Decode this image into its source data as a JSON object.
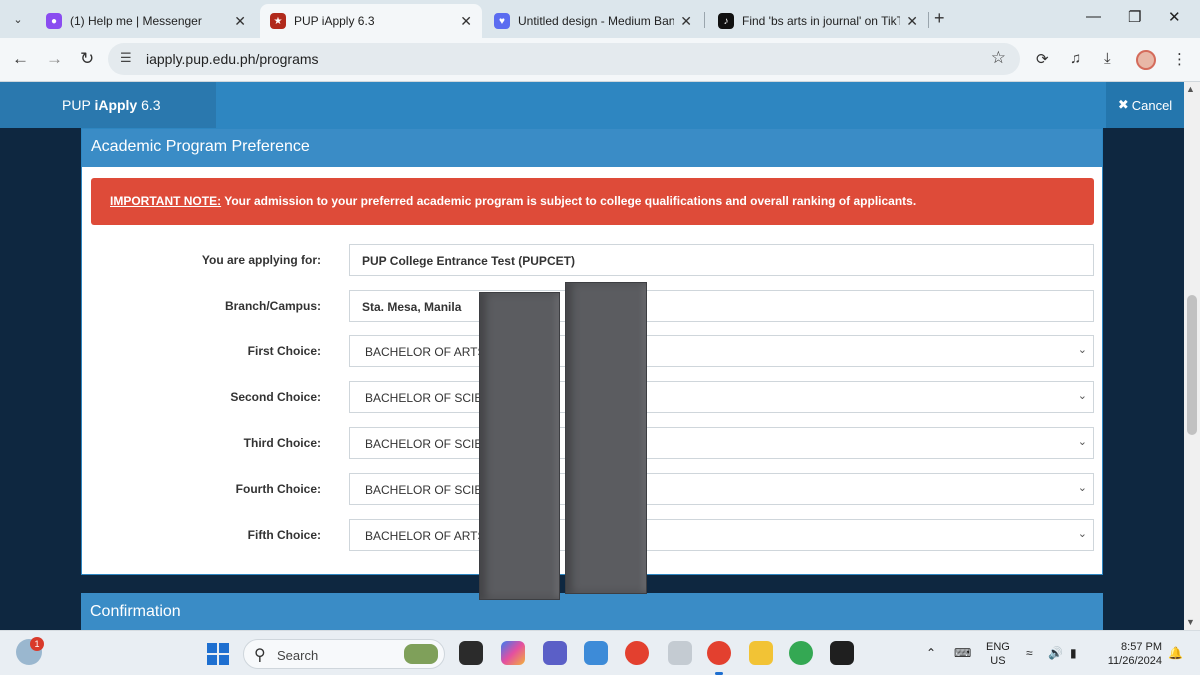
{
  "browser": {
    "tabs": [
      {
        "title": "(1) Help me | Messenger",
        "favicon_color": "#8a4cf0",
        "active": false
      },
      {
        "title": "PUP iApply 6.3",
        "favicon_color": "#b12a1c",
        "active": true
      },
      {
        "title": "Untitled design - Medium Bann",
        "favicon_color": "#5b6cf0",
        "active": false
      },
      {
        "title": "Find 'bs arts in journal' on TikTo",
        "favicon_color": "#111111",
        "active": false
      }
    ],
    "new_tab_label": "+",
    "url": "iapply.pup.edu.ph/programs"
  },
  "app": {
    "brand_prefix": "PUP ",
    "brand_bold": "iApply",
    "brand_version": " 6.3",
    "cancel_label": "Cancel",
    "accent_color": "#2e86c1"
  },
  "preference_panel": {
    "title": "Academic Program Preference",
    "note_label": "IMPORTANT NOTE:",
    "note_text": " Your admission to your preferred academic program is subject to college qualifications and overall ranking of applicants.",
    "applying_for": {
      "label": "You are applying for:",
      "value": "PUP College Entrance Test (PUPCET)"
    },
    "campus": {
      "label": "Branch/Campus:",
      "value": "Sta. Mesa, Manila"
    },
    "choices": [
      {
        "label": "First Choice:",
        "value": "BACHELOR OF ARTS I"
      },
      {
        "label": "Second Choice:",
        "value": "BACHELOR OF SCIEN"
      },
      {
        "label": "Third Choice:",
        "value": "BACHELOR OF SCIEN"
      },
      {
        "label": "Fourth Choice:",
        "value": "BACHELOR OF SCIEN"
      },
      {
        "label": "Fifth Choice:",
        "value": "BACHELOR OF ARTS I"
      }
    ]
  },
  "confirmation_panel": {
    "title": "Confirmation"
  },
  "taskbar": {
    "search_placeholder": "Search",
    "notification_count": "1",
    "lang_line1": "ENG",
    "lang_line2": "US",
    "time": "8:57 PM",
    "date": "11/26/2024"
  }
}
